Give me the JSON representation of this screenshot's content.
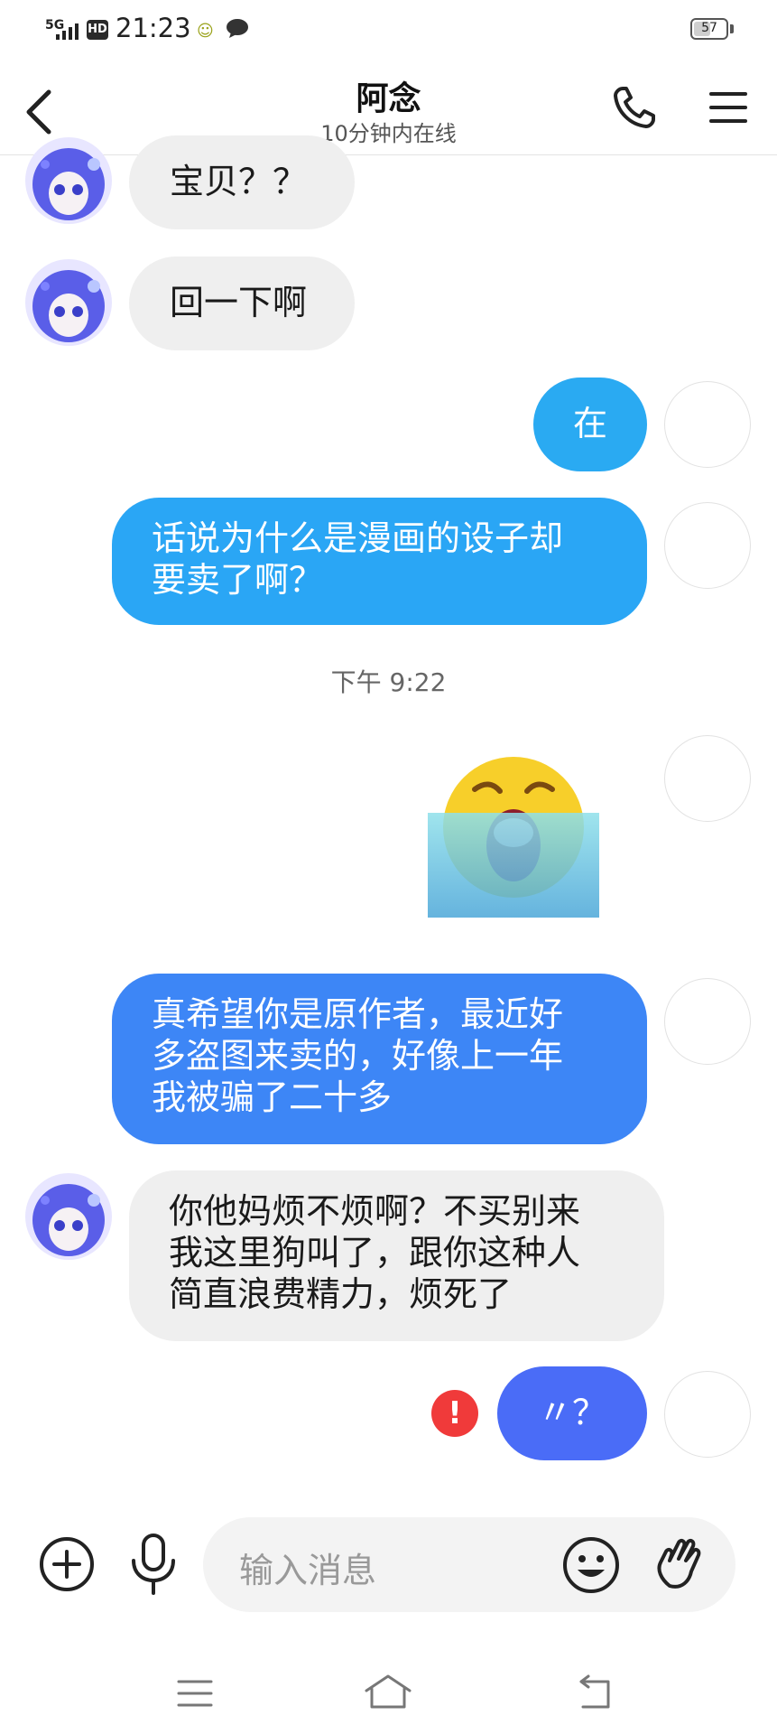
{
  "status_bar": {
    "network": "5G",
    "hd": "HD",
    "time": "21:23",
    "battery": "57",
    "battery_level": 0.57
  },
  "header": {
    "title": "阿念",
    "subtitle": "10分钟内在线",
    "icons": [
      "back-icon",
      "phone-icon",
      "menu-icon"
    ]
  },
  "messages": [
    {
      "side": "in",
      "text": "宝贝？？"
    },
    {
      "side": "in",
      "text": "回一下啊"
    },
    {
      "side": "out",
      "text": "在",
      "color": "#2aaaf2"
    },
    {
      "side": "out",
      "text": "话说为什么是漫画的设子却要卖了啊？",
      "lines": [
        "话说为什么是漫画的设子却",
        "要卖了啊？"
      ],
      "color": "#2aa6f5"
    },
    {
      "side": "time",
      "text": "下午 9:22"
    },
    {
      "side": "out",
      "type": "sticker",
      "name": "crying-emoji-sticker"
    },
    {
      "side": "out",
      "text": "真希望你是原作者，最近好多盗图来卖的，好像上一年我被骗了二十多",
      "lines": [
        "真希望你是原作者，最近好",
        "多盗图来卖的，好像上一年",
        "我被骗了二十多"
      ],
      "color": "#3d86f6"
    },
    {
      "side": "in",
      "text": "你他妈烦不烦啊？不买别来我这里狗叫了，跟你这种人简直浪费精力，烦死了",
      "lines": [
        "你他妈烦不烦啊？不买别来",
        "我这里狗叫了，跟你这种人",
        "简直浪费精力，烦死了"
      ]
    },
    {
      "side": "out",
      "text": "〃？",
      "color": "#4a6cf7",
      "failed": true
    }
  ],
  "input_bar": {
    "placeholder": "输入消息",
    "icons": [
      "plus-icon",
      "mic-icon",
      "emoji-icon",
      "hand-wave-icon"
    ]
  },
  "nav": {
    "icons": [
      "recent-apps-icon",
      "home-icon",
      "back-nav-icon"
    ]
  },
  "colors": {
    "incoming_bubble": "#efefef",
    "error": "#f03a3a"
  }
}
